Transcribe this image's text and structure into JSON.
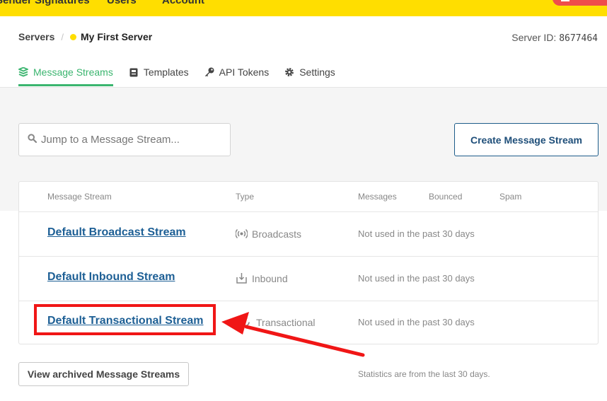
{
  "topnav": {
    "items": [
      "Sender Signatures",
      "Users",
      "Account"
    ]
  },
  "breadcrumb": {
    "servers_label": "Servers",
    "separator": "/",
    "server_name": "My First Server"
  },
  "server_id": {
    "label": "Server ID:",
    "value": "8677464"
  },
  "tabs": [
    {
      "label": "Message Streams",
      "icon": "layers-icon",
      "active": true
    },
    {
      "label": "Templates",
      "icon": "template-icon",
      "active": false
    },
    {
      "label": "API Tokens",
      "icon": "key-icon",
      "active": false
    },
    {
      "label": "Settings",
      "icon": "gear-icon",
      "active": false
    }
  ],
  "search": {
    "placeholder": "Jump to a Message Stream..."
  },
  "create_button": "Create Message Stream",
  "table": {
    "headers": [
      "Message Stream",
      "Type",
      "Messages",
      "Bounced",
      "Spam"
    ],
    "rows": [
      {
        "name": "Default Broadcast Stream",
        "type": "Broadcasts",
        "type_icon": "broadcast-icon",
        "messages": "Not used in the past 30 days"
      },
      {
        "name": "Default Inbound Stream",
        "type": "Inbound",
        "type_icon": "inbox-icon",
        "messages": "Not used in the past 30 days"
      },
      {
        "name": "Default Transactional Stream",
        "type": "Transactional",
        "type_icon": "transactional-icon",
        "messages": "Not used in the past 30 days"
      }
    ]
  },
  "archived_button": "View archived Message Streams",
  "stats_note": "Statistics are from the last 30 days.",
  "colors": {
    "brand_yellow": "#ffde00",
    "accent_green": "#3bb56f",
    "link_blue": "#1d5f95",
    "annotation_red": "#f01616"
  }
}
